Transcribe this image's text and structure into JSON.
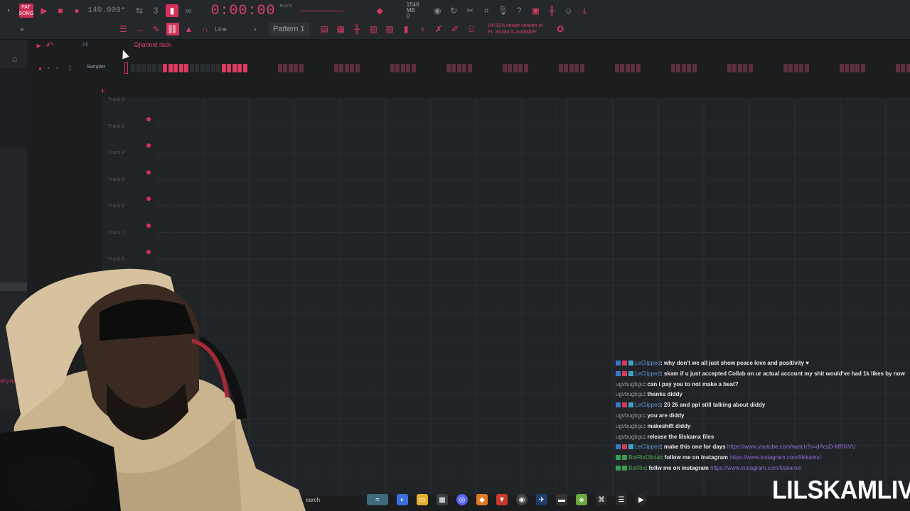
{
  "toolbar": {
    "song_badge": "PAT SONG",
    "bpm": "140.000",
    "time": "0:00:00",
    "time_unit": "M:S:CS",
    "cpu": "1546 MB",
    "cpu_sub": "0",
    "snap_label": "Line",
    "pattern": "Pattern 1",
    "news_line1": "04:23 A newer version of",
    "news_line2": "FL Studio is available!"
  },
  "channel_rack": {
    "filter": "All",
    "title": "Channel rack",
    "channel_number": "1",
    "channel_name": "Sampler"
  },
  "playlist": {
    "tracks": [
      "Track 2",
      "Track 3",
      "Track 4",
      "Track 5",
      "Track 6",
      "Track 7",
      "Track 8"
    ]
  },
  "chat": {
    "messages": [
      {
        "user": "LeClipped",
        "text": ": why don't we all just show peace love and positivity ♥",
        "link": "",
        "color": "blue"
      },
      {
        "user": "LeClipped",
        "text": ": skam if u just accepted Collab on ur actual account my shit would've had 1k likes by now",
        "link": "",
        "color": "blue"
      },
      {
        "user": "ugvbugbgu",
        "text": ": can i pay you to not make a beat?",
        "link": "",
        "color": "grey"
      },
      {
        "user": "ugvbugbgu",
        "text": ": thanks diddy",
        "link": "",
        "color": "grey"
      },
      {
        "user": "LeClipped",
        "text": ": 20 26 and ppl still talking about diddy",
        "link": "",
        "color": "blue"
      },
      {
        "user": "ugvbugbgu",
        "text": ": you are diddy",
        "link": "",
        "color": "grey"
      },
      {
        "user": "ugvbugbgu",
        "text": ": makeshift diddy",
        "link": "",
        "color": "grey"
      },
      {
        "user": "ugvbugbgu",
        "text": ": release the lilskamx files",
        "link": "",
        "color": "grey"
      },
      {
        "user": "LeClipped",
        "text": ": make this one for days ",
        "link": "https://www.youtube.com/watch?v=dAcsD-MRNVU",
        "color": "blue"
      },
      {
        "user": "BotRixOficial",
        "text": ": follow me on instagram ",
        "link": "https://www.instagram.com/lilskamx/",
        "color": "green"
      },
      {
        "user": "BotRix",
        "text": ": follw me on instagram ",
        "link": "https://www.instagram.com/lilskamx/",
        "color": "green"
      }
    ]
  },
  "taskbar": {
    "search": "earch"
  },
  "watermark": "LILSKAMLIVE",
  "side_label": "abyxp",
  "colors": {
    "accent": "#d2325a",
    "panel": "#25282b",
    "background": "#1b1d1f"
  }
}
